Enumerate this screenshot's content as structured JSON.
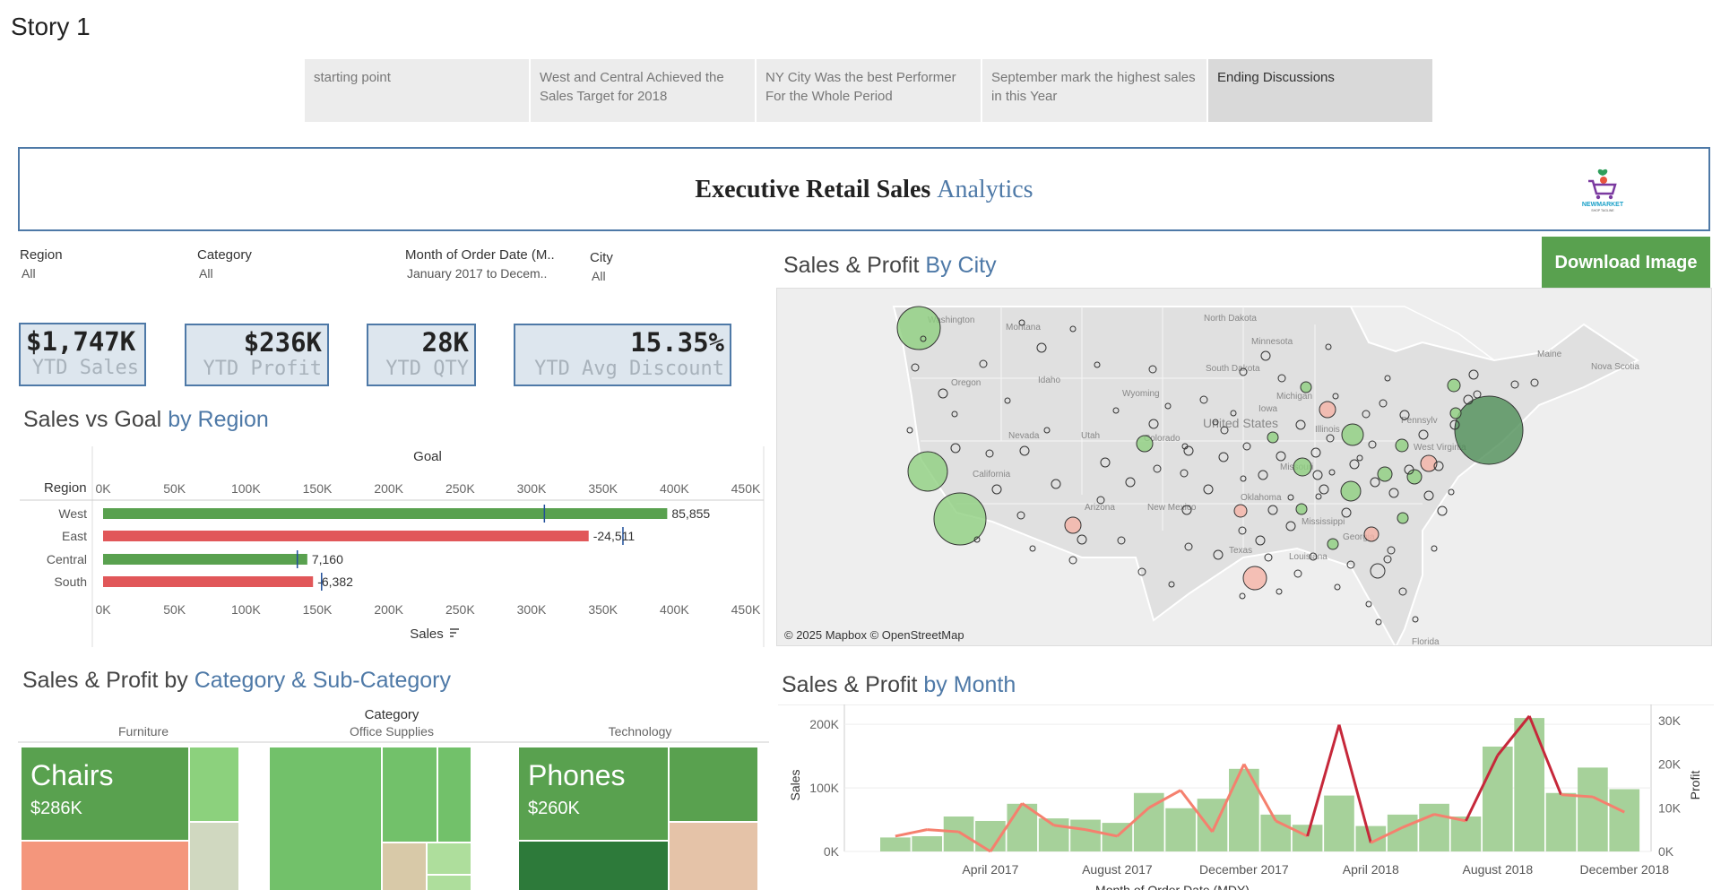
{
  "story": {
    "title": "Story 1"
  },
  "tabs": [
    {
      "label": "starting point",
      "active": false
    },
    {
      "label": "West and Central Achieved the Sales Target for 2018",
      "active": false
    },
    {
      "label": "NY City Was the best Performer For the Whole Period",
      "active": false
    },
    {
      "label": "September mark the highest sales in this Year",
      "active": false
    },
    {
      "label": "Ending Discussions",
      "active": true
    }
  ],
  "header": {
    "title_main": "Executive  Retail Sales ",
    "title_accent": "Analytics",
    "logo_text": "NEWMARKET",
    "logo_tagline": "SHOP TAGLINE"
  },
  "filters": [
    {
      "label": "Region",
      "value": "All"
    },
    {
      "label": "Category",
      "value": "All"
    },
    {
      "label": "Month of Order Date (M..",
      "value": "January 2017 to Decem.."
    },
    {
      "label": "City",
      "value": "All"
    }
  ],
  "kpis": [
    {
      "value": "$1,747K",
      "caption": "YTD Sales"
    },
    {
      "value": "$236K",
      "caption": "YTD Profit"
    },
    {
      "value": "28K",
      "caption": "YTD QTY"
    },
    {
      "value": "15.35%",
      "caption": "YTD Avg Discount"
    }
  ],
  "sections": {
    "region_title": "Sales vs Goal ",
    "region_accent": "by Region",
    "city_title": "Sales & Profit ",
    "city_accent": "By City",
    "category_title": "Sales & Profit by ",
    "category_accent": "Category & Sub-Category",
    "month_title": "Sales & Profit ",
    "month_accent": "by Month"
  },
  "download": {
    "label": "Download Image"
  },
  "map": {
    "credit": "© 2025 Mapbox © OpenStreetMap",
    "labels": [
      "Washington",
      "Montana",
      "North Dakota",
      "Minnesota",
      "Oregon",
      "Idaho",
      "South Dakota",
      "Wyoming",
      "Michigan",
      "Iowa",
      "Nevada",
      "Utah",
      "Colorado",
      "United States",
      "Illinois",
      "Pennsylv",
      "Maine",
      "Nova Scotia",
      "West Virginia",
      "California",
      "Missouri",
      "Oklahoma",
      "Arizona",
      "New Mexico",
      "Mississippi",
      "Georgia",
      "Texas",
      "Louisiana",
      "Florida"
    ]
  },
  "colors": {
    "positive": "#59a14f",
    "negative": "#e15759",
    "accent": "#4e79a7",
    "goal_marker": "#1f4e99",
    "profit_line": "#e15759",
    "sales_bar": "#a6d19a"
  },
  "region_chart": {
    "type": "bar",
    "title": "Goal",
    "row_header": "Region",
    "xlabel": "Sales",
    "ticks": [
      "0K",
      "50K",
      "100K",
      "150K",
      "200K",
      "250K",
      "300K",
      "350K",
      "400K",
      "450K"
    ],
    "xlim": [
      0,
      450000
    ],
    "categories": [
      "West",
      "East",
      "Central",
      "South"
    ],
    "values": [
      395000,
      340000,
      143000,
      147000
    ],
    "goals": [
      309000,
      364000,
      136000,
      153000
    ],
    "labels": [
      "85,855",
      "-24,511",
      "7,160",
      "-6,382"
    ],
    "status": [
      "positive",
      "negative",
      "positive",
      "negative"
    ]
  },
  "category_chart": {
    "header": "Category",
    "columns": [
      {
        "name": "Furniture",
        "top_label": "Chairs",
        "top_value": "$286K"
      },
      {
        "name": "Office Supplies",
        "top_label": "",
        "top_value": ""
      },
      {
        "name": "Technology",
        "top_label": "Phones",
        "top_value": "$260K"
      }
    ]
  },
  "chart_data": {
    "type": "bar",
    "x": [
      "Jan 2017",
      "Feb 2017",
      "Mar 2017",
      "Apr 2017",
      "May 2017",
      "Jun 2017",
      "Jul 2017",
      "Aug 2017",
      "Sep 2017",
      "Oct 2017",
      "Nov 2017",
      "Dec 2017",
      "Jan 2018",
      "Feb 2018",
      "Mar 2018",
      "Apr 2018",
      "May 2018",
      "Jun 2018",
      "Jul 2018",
      "Aug 2018",
      "Sep 2018",
      "Oct 2018",
      "Nov 2018",
      "Dec 2018"
    ],
    "x_tick_labels": [
      "April 2017",
      "August 2017",
      "December 2017",
      "April 2018",
      "August 2018",
      "December 2018"
    ],
    "xlabel": "Month of Order Date (MDY)",
    "ylabel": "Sales",
    "y2label": "Profit",
    "ylim": [
      0,
      220000
    ],
    "y2lim": [
      0,
      32000
    ],
    "y_ticks": [
      "0K",
      "100K",
      "200K"
    ],
    "y2_ticks": [
      "0K",
      "10K",
      "20K",
      "30K"
    ],
    "series": [
      {
        "name": "Sales",
        "type": "bar",
        "values": [
          22000,
          24000,
          55000,
          48000,
          75000,
          52000,
          50000,
          45000,
          92000,
          68000,
          83000,
          130000,
          58000,
          42000,
          88000,
          40000,
          58000,
          75000,
          55000,
          165000,
          210000,
          92000,
          132000,
          98000
        ]
      },
      {
        "name": "Profit",
        "type": "line",
        "axis": "y2",
        "values": [
          3500,
          5000,
          4500,
          0,
          11000,
          6000,
          5000,
          3500,
          10000,
          14000,
          4500,
          20000,
          7000,
          3500,
          29000,
          2000,
          5500,
          8500,
          7000,
          22000,
          31000,
          13000,
          12500,
          9000
        ]
      }
    ]
  }
}
